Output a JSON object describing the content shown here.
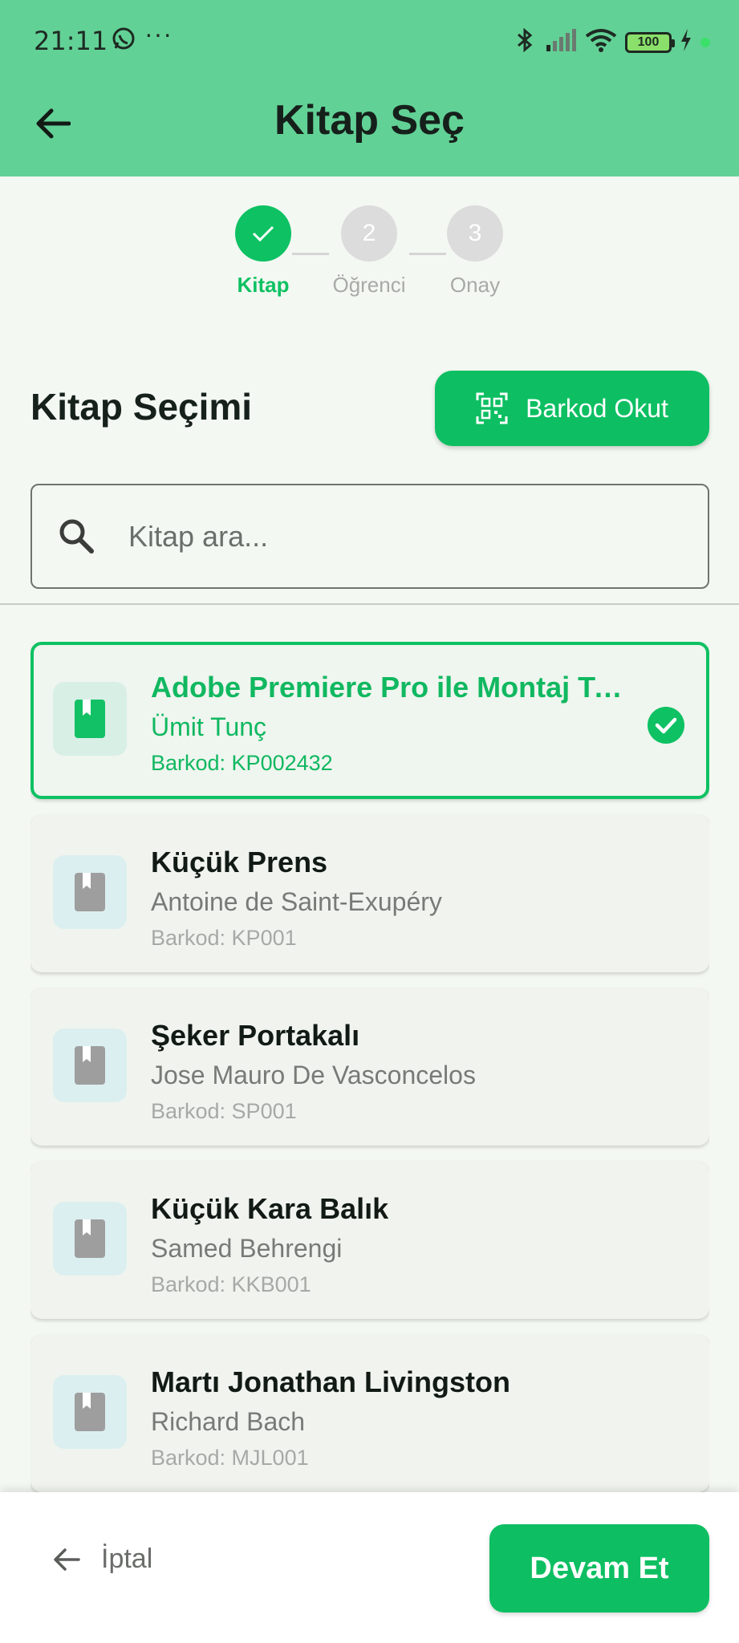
{
  "status_bar": {
    "time": "21:11",
    "dots": "···",
    "battery": "100"
  },
  "header": {
    "title": "Kitap Seç"
  },
  "stepper": {
    "steps": [
      {
        "number": "✓",
        "label": "Kitap",
        "state": "done"
      },
      {
        "number": "2",
        "label": "Öğrenci",
        "state": "todo"
      },
      {
        "number": "3",
        "label": "Onay",
        "state": "todo"
      }
    ]
  },
  "section": {
    "title": "Kitap Seçimi",
    "barcode_button": "Barkod Okut"
  },
  "search": {
    "placeholder": "Kitap ara...",
    "value": ""
  },
  "books": [
    {
      "title": "Adobe Premiere Pro ile Montaj Te...",
      "author": "Ümit Tunç",
      "barcode": "Barkod: KP002432",
      "selected": true
    },
    {
      "title": "Küçük Prens",
      "author": "Antoine de Saint-Exupéry",
      "barcode": "Barkod: KP001",
      "selected": false
    },
    {
      "title": "Şeker Portakalı",
      "author": "Jose Mauro De Vasconcelos",
      "barcode": "Barkod: SP001",
      "selected": false
    },
    {
      "title": "Küçük Kara Balık",
      "author": "Samed Behrengi",
      "barcode": "Barkod: KKB001",
      "selected": false
    },
    {
      "title": "Martı Jonathan Livingston",
      "author": "Richard Bach",
      "barcode": "Barkod: MJL001",
      "selected": false
    }
  ],
  "bottom_bar": {
    "cancel_label": "İptal",
    "continue_label": "Devam Et"
  },
  "colors": {
    "header_bg": "#62d196",
    "accent": "#0ec163",
    "background": "#f4f8f2"
  },
  "icons": {
    "back": "arrow-left-icon",
    "barcode": "qr-scan-icon",
    "search": "search-icon",
    "book": "book-icon",
    "check": "check-circle-icon"
  }
}
